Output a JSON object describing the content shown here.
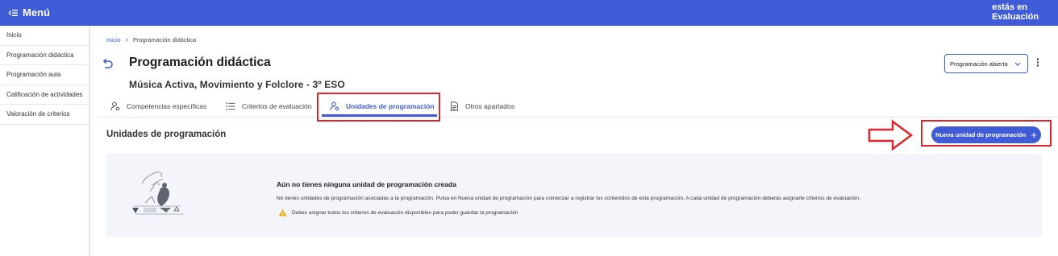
{
  "topbar": {
    "menu_label": "Menú",
    "right_text_line1": "estás en",
    "right_text_line2": "Evaluación",
    "color": "#3f5bd6"
  },
  "sidebar": {
    "items": [
      {
        "label": "Inicio"
      },
      {
        "label": "Programación didáctica"
      },
      {
        "label": "Programación aula"
      },
      {
        "label": "Calificación de actividades"
      },
      {
        "label": "Valoración de criterios"
      }
    ]
  },
  "breadcrumb": {
    "home": "Inicio",
    "current": "Programación didáctica"
  },
  "header": {
    "title": "Programación didáctica",
    "subtitle": "Música Activa, Movimiento y Folclore - 3º ESO",
    "status_select": "Programación abierta"
  },
  "tabs": [
    {
      "label": "Competencias específicas",
      "icon": "competency-icon"
    },
    {
      "label": "Criterios de evaluación",
      "icon": "list-icon"
    },
    {
      "label": "Unidades de programación",
      "icon": "units-icon",
      "active": true
    },
    {
      "label": "Otros apartados",
      "icon": "document-icon"
    }
  ],
  "section": {
    "title": "Unidades de programación",
    "new_button": "Nueva unidad de programación"
  },
  "empty_state": {
    "title": "Aún no tienes ninguna unidad de programación creada",
    "description": "No tienes unidades de programación asociadas a la programación. Pulsa en Nueva unidad de programación para comenzar a registrar los contenidos de esta programación. A cada unidad de programación deberás asignarle criterios de evaluación.",
    "warning": "Debes asignar todos los criterios de evaluación disponibles para poder guardar la programación"
  },
  "colors": {
    "accent": "#3f5bd6",
    "highlight": "#e0242b",
    "warning": "#f2b01e"
  }
}
